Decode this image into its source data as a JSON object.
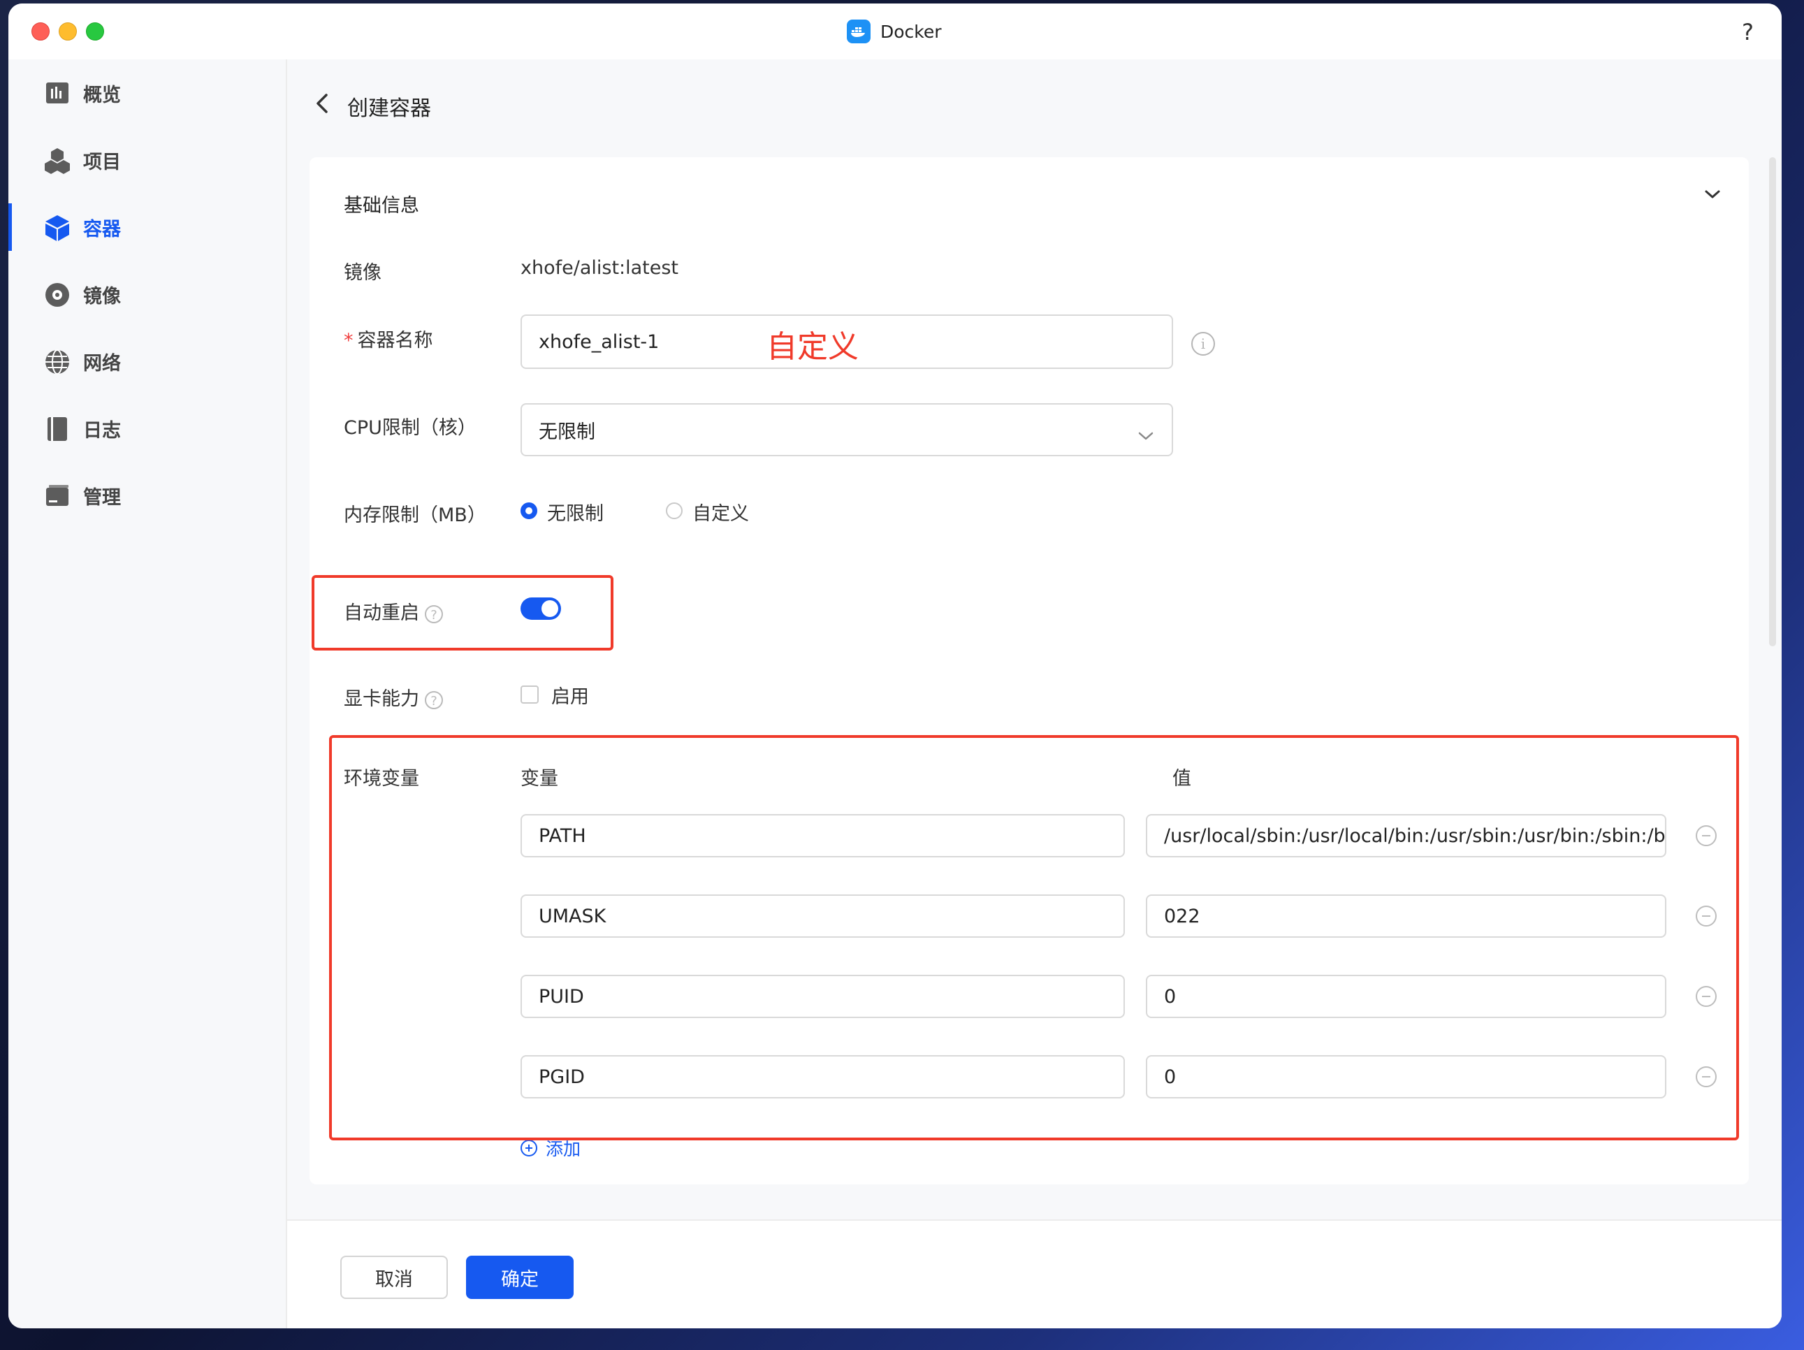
{
  "window": {
    "title": "Docker",
    "help": "?"
  },
  "sidebar": {
    "items": [
      {
        "label": "概览",
        "icon": "chart-icon"
      },
      {
        "label": "项目",
        "icon": "cubes-icon"
      },
      {
        "label": "容器",
        "icon": "box-icon",
        "active": true
      },
      {
        "label": "镜像",
        "icon": "disc-icon"
      },
      {
        "label": "网络",
        "icon": "globe-icon"
      },
      {
        "label": "日志",
        "icon": "book-icon"
      },
      {
        "label": "管理",
        "icon": "drive-icon"
      }
    ]
  },
  "page": {
    "title": "创建容器"
  },
  "basic": {
    "section_title": "基础信息",
    "image_label": "镜像",
    "image_value": "xhofe/alist:latest",
    "name_label": "容器名称",
    "name_value": "xhofe_alist-1",
    "cpu_label": "CPU限制（核）",
    "cpu_value": "无限制",
    "memory_label": "内存限制（MB）",
    "memory_options": [
      "无限制",
      "自定义"
    ],
    "memory_selected": "无限制",
    "restart_label": "自动重启",
    "restart_on": true,
    "gpu_label": "显卡能力",
    "gpu_checkbox_label": "启用"
  },
  "env": {
    "label": "环境变量",
    "col_var": "变量",
    "col_value": "值",
    "rows": [
      {
        "key": "PATH",
        "value": "/usr/local/sbin:/usr/local/bin:/usr/sbin:/usr/bin:/sbin:/bin"
      },
      {
        "key": "UMASK",
        "value": "022"
      },
      {
        "key": "PUID",
        "value": "0"
      },
      {
        "key": "PGID",
        "value": "0"
      }
    ],
    "add_label": "添加"
  },
  "annotation": {
    "text": "自定义",
    "color": "#f03a2a"
  },
  "footer": {
    "cancel_label": "取消",
    "ok_label": "确定"
  },
  "colors": {
    "accent": "#1659f0"
  }
}
